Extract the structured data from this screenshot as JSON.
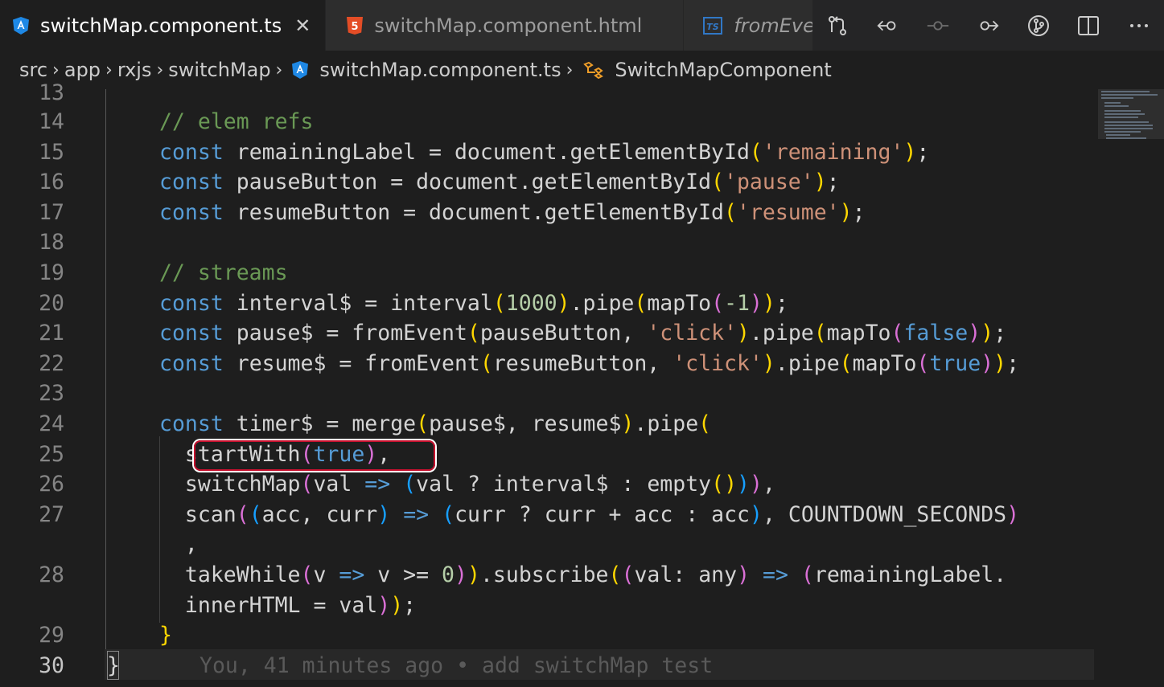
{
  "tabs": [
    {
      "label": "switchMap.component.ts",
      "icon": "angular-icon",
      "active": true
    },
    {
      "label": "switchMap.component.html",
      "icon": "html5-icon",
      "active": false
    },
    {
      "label": "fromEvent",
      "icon": "typescript-icon",
      "active": false
    }
  ],
  "close_glyph": "✕",
  "breadcrumb": [
    "src",
    "app",
    "rxjs",
    "switchMap",
    "switchMap.component.ts",
    "SwitchMapComponent"
  ],
  "editor": {
    "line_numbers": [
      "13",
      "14",
      "15",
      "16",
      "17",
      "18",
      "19",
      "20",
      "21",
      "22",
      "23",
      "24",
      "25",
      "26",
      "27",
      "",
      "28",
      "",
      "29",
      "30"
    ],
    "blame": "You, 41 minutes ago • add switchMap test",
    "lines": {
      "l14_comment": "// elem refs",
      "l15_a": "const",
      "l15_b": " remainingLabel = document.getElementById",
      "l15_c": "(",
      "l15_d": "'remaining'",
      "l15_e": ")",
      "l15_f": ";",
      "l16_a": "const",
      "l16_b": " pauseButton = document.getElementById",
      "l16_c": "(",
      "l16_d": "'pause'",
      "l16_e": ")",
      "l16_f": ";",
      "l17_a": "const",
      "l17_b": " resumeButton = document.getElementById",
      "l17_c": "(",
      "l17_d": "'resume'",
      "l17_e": ")",
      "l17_f": ";",
      "l19_comment": "// streams",
      "l20_a": "const",
      "l20_b": " interval$ = interval",
      "l20_c": "(",
      "l20_d": "1000",
      "l20_e": ")",
      "l20_f": ".pipe",
      "l20_g": "(",
      "l20_h": "mapTo",
      "l20_i": "(",
      "l20_j": "-1",
      "l20_k": ")",
      "l20_l": ")",
      "l20_m": ";",
      "l21_a": "const",
      "l21_b": " pause$ = fromEvent",
      "l21_c": "(",
      "l21_d": "pauseButton, ",
      "l21_e": "'click'",
      "l21_f": ")",
      "l21_g": ".pipe",
      "l21_h": "(",
      "l21_i": "mapTo",
      "l21_j": "(",
      "l21_k": "false",
      "l21_l": ")",
      "l21_m": ")",
      "l21_n": ";",
      "l22_a": "const",
      "l22_b": " resume$ = fromEvent",
      "l22_c": "(",
      "l22_d": "resumeButton, ",
      "l22_e": "'click'",
      "l22_f": ")",
      "l22_g": ".pipe",
      "l22_h": "(",
      "l22_i": "mapTo",
      "l22_j": "(",
      "l22_k": "true",
      "l22_l": ")",
      "l22_m": ")",
      "l22_n": ";",
      "l24_a": "const",
      "l24_b": " timer$ = merge",
      "l24_c": "(",
      "l24_d": "pause$, resume$",
      "l24_e": ")",
      "l24_f": ".pipe",
      "l24_g": "(",
      "l25_a": "  startWith",
      "l25_b": "(",
      "l25_c": "true",
      "l25_d": ")",
      "l25_e": ",",
      "l26_a": "  switchMap",
      "l26_b": "(",
      "l26_c": "val ",
      "l26_d": "=>",
      "l26_e": " ",
      "l26_f": "(",
      "l26_g": "val ? interval$ : empty",
      "l26_h": "(",
      "l26_i": ")",
      "l26_j": ")",
      "l26_k": ")",
      "l26_l": ",",
      "l27_a": "  scan",
      "l27_b": "(",
      "l27_c": "(",
      "l27_d": "acc, curr",
      "l27_e": ")",
      "l27_f": " ",
      "l27_g": "=>",
      "l27_h": " ",
      "l27_i": "(",
      "l27_j": "curr ? curr + acc : acc",
      "l27_k": ")",
      "l27_l": ", COUNTDOWN_SECONDS",
      "l27_m": ")",
      "l27_wrap": "  ,",
      "l28_a": "  takeWhile",
      "l28_b": "(",
      "l28_c": "v ",
      "l28_d": "=>",
      "l28_e": " v >= ",
      "l28_f": "0",
      "l28_g": ")",
      "l28_h": ")",
      "l28_i": ".subscribe",
      "l28_j": "(",
      "l28_k": "(",
      "l28_l": "val: any",
      "l28_m": ")",
      "l28_n": " ",
      "l28_o": "=>",
      "l28_p": " ",
      "l28_q": "(",
      "l28_r": "remainingLabel.",
      "l28_wrap_a": "  innerHTML = val",
      "l28_wrap_b": ")",
      "l28_wrap_c": ")",
      "l28_wrap_d": ";",
      "l29": "}",
      "l30": "}"
    }
  }
}
